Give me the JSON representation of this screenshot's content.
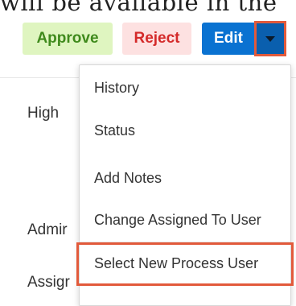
{
  "header": {
    "partial_text": "will be available in the"
  },
  "actions": {
    "approve_label": "Approve",
    "reject_label": "Reject",
    "edit_label": "Edit"
  },
  "fields": {
    "priority_value": "High",
    "admin_label_partial": "Admir",
    "assigned_label_partial": "Assigr"
  },
  "menu": {
    "items": [
      {
        "label": "History"
      },
      {
        "label": "Status"
      },
      {
        "label": "Add Notes"
      },
      {
        "label": "Change Assigned To User"
      },
      {
        "label": "Select New Process User"
      }
    ]
  },
  "colors": {
    "highlight": "#e25a3b",
    "primary": "#0a72d1",
    "approve_bg": "#dff5c0",
    "reject_bg": "#fde1e1"
  },
  "icons": {
    "caret": "caret-down-icon"
  }
}
